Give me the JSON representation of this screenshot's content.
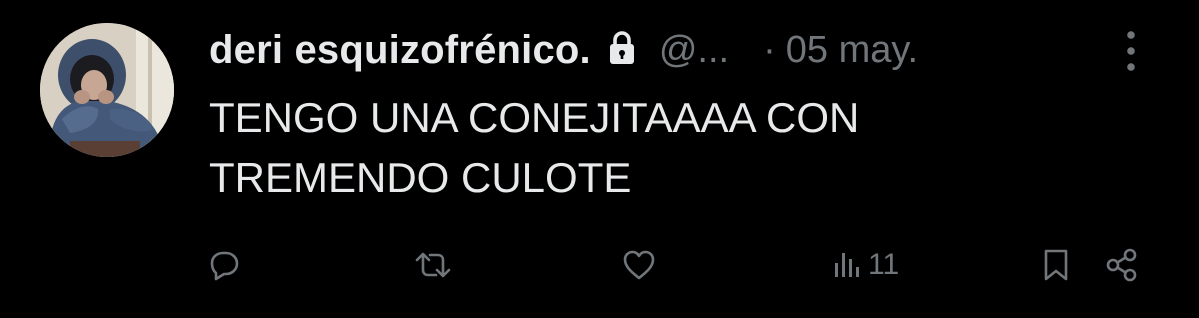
{
  "tweet": {
    "author": {
      "display_name": "deri esquizofrénico.",
      "handle": "@...",
      "protected_icon": "lock-icon",
      "avatar_icon": "avatar"
    },
    "separator": "·",
    "date": "05 may.",
    "text_lines": [
      "TENGO UNA CONEJITAAAA CON",
      "TREMENDO CULOTE"
    ],
    "actions": {
      "reply_icon": "reply-icon",
      "retweet_icon": "retweet-icon",
      "like_icon": "heart-icon",
      "views_icon": "analytics-icon",
      "views_count": "11",
      "bookmark_icon": "bookmark-icon",
      "share_icon": "share-icon"
    },
    "more_icon": "more-vertical-icon"
  },
  "colors": {
    "background": "#000000",
    "primary_text": "#e7e9ea",
    "secondary_text": "#71767b"
  }
}
